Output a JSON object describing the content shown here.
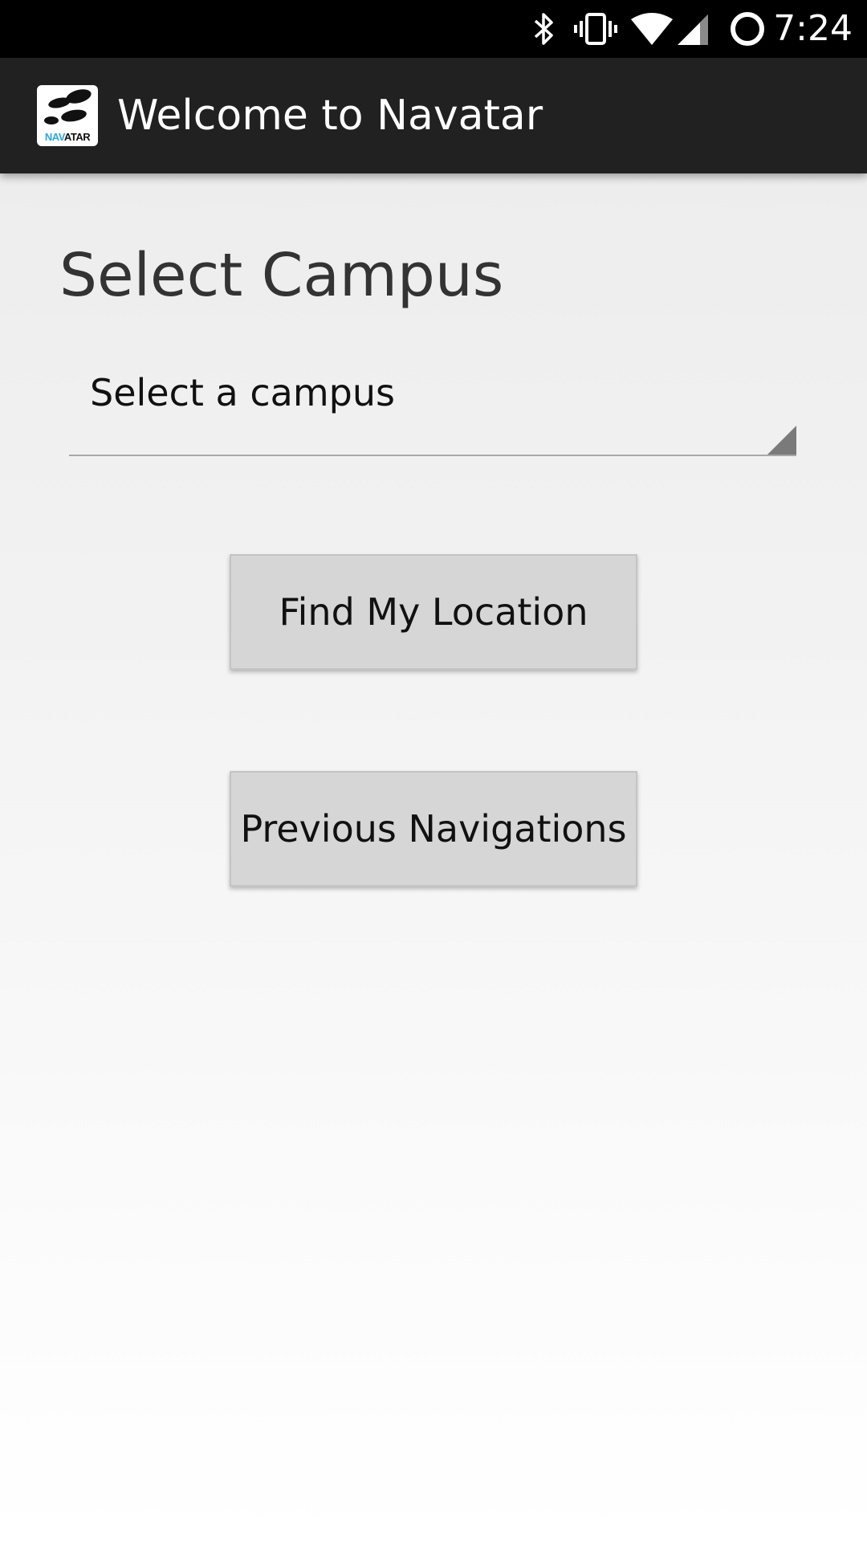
{
  "status_bar": {
    "time": "7:24",
    "icons": [
      "bluetooth-icon",
      "vibrate-icon",
      "wifi-icon",
      "cell-signal-icon",
      "sync-icon"
    ]
  },
  "app_bar": {
    "title": "Welcome to Navatar",
    "logo": {
      "text_nav": "NAV",
      "text_atar": "ATAR",
      "nav_color": "#2aa6e0"
    }
  },
  "main": {
    "heading": "Select Campus",
    "campus_spinner": {
      "selected": "Select a campus"
    },
    "buttons": {
      "find_location": "Find My Location",
      "previous_navigations": "Previous Navigations"
    }
  },
  "colors": {
    "status_bar_bg": "#000000",
    "app_bar_bg": "#212121",
    "button_bg": "#d6d6d6"
  }
}
